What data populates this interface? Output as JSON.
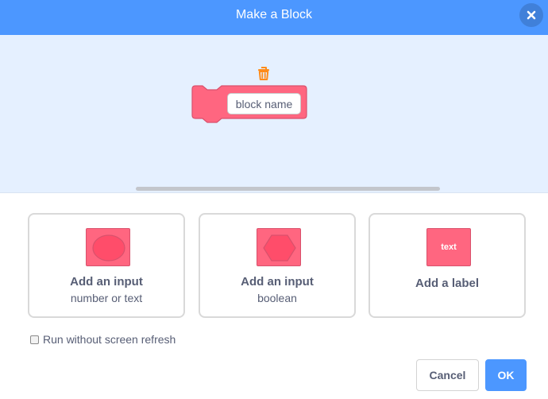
{
  "dialog": {
    "title": "Make a Block"
  },
  "preview": {
    "block_name_value": "block name"
  },
  "options": [
    {
      "title": "Add an input",
      "subtitle": "number or text",
      "icon": "round-input-icon"
    },
    {
      "title": "Add an input",
      "subtitle": "boolean",
      "icon": "boolean-input-icon"
    },
    {
      "title": "Add a label",
      "subtitle": "",
      "icon": "text-label-icon",
      "icon_text": "text"
    }
  ],
  "checkbox": {
    "label": "Run without screen refresh",
    "checked": false
  },
  "buttons": {
    "cancel": "Cancel",
    "ok": "OK"
  },
  "colors": {
    "header": "#4c97ff",
    "preview_bg": "#e5f0ff",
    "block": "#ff6680",
    "block_border": "#d9516c",
    "trash": "#ff8c1a",
    "text": "#575e75"
  }
}
